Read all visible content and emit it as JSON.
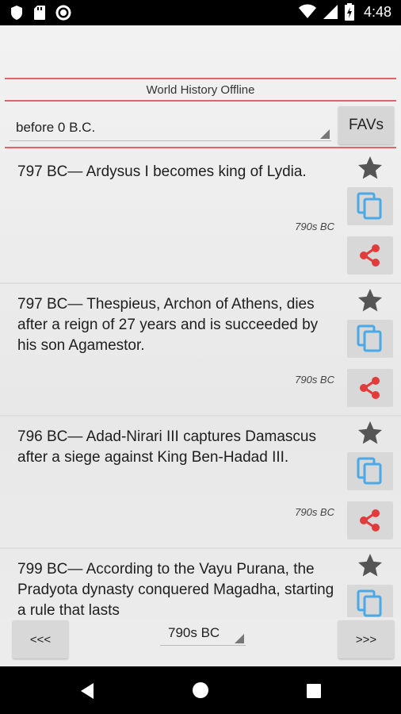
{
  "status_bar": {
    "time": "4:48",
    "left_icons": [
      "shield-icon",
      "sd-card-icon",
      "circle-record-icon"
    ],
    "right_icons": [
      "wifi-icon",
      "signal-icon",
      "battery-icon"
    ]
  },
  "app": {
    "title": "World History Offline",
    "era_select_value": "before 0 B.C.",
    "favs_label": "FAVs"
  },
  "items": [
    {
      "text": "797 BC— Ardysus I becomes king of Lydia.",
      "decade": "790s BC"
    },
    {
      "text": "797 BC— Thespieus, Archon of Athens, dies after a reign of 27 years and is succeeded by his son Agamestor.",
      "decade": "790s BC"
    },
    {
      "text": "796 BC— Adad-Nirari III captures Damascus after a siege against King Ben-Hadad III.",
      "decade": "790s BC"
    },
    {
      "text": "799 BC— According to the Vayu Purana, the Pradyota dynasty conquered Magadha, starting a rule that lasts",
      "decade": ""
    }
  ],
  "bottom": {
    "prev_label": "<<<",
    "next_label": ">>>",
    "decade_select_value": "790s BC"
  },
  "colors": {
    "accent_red": "#e06464",
    "copy_blue": "#4aa9e6",
    "share_red": "#e23b3b",
    "star_gray": "#555555"
  }
}
